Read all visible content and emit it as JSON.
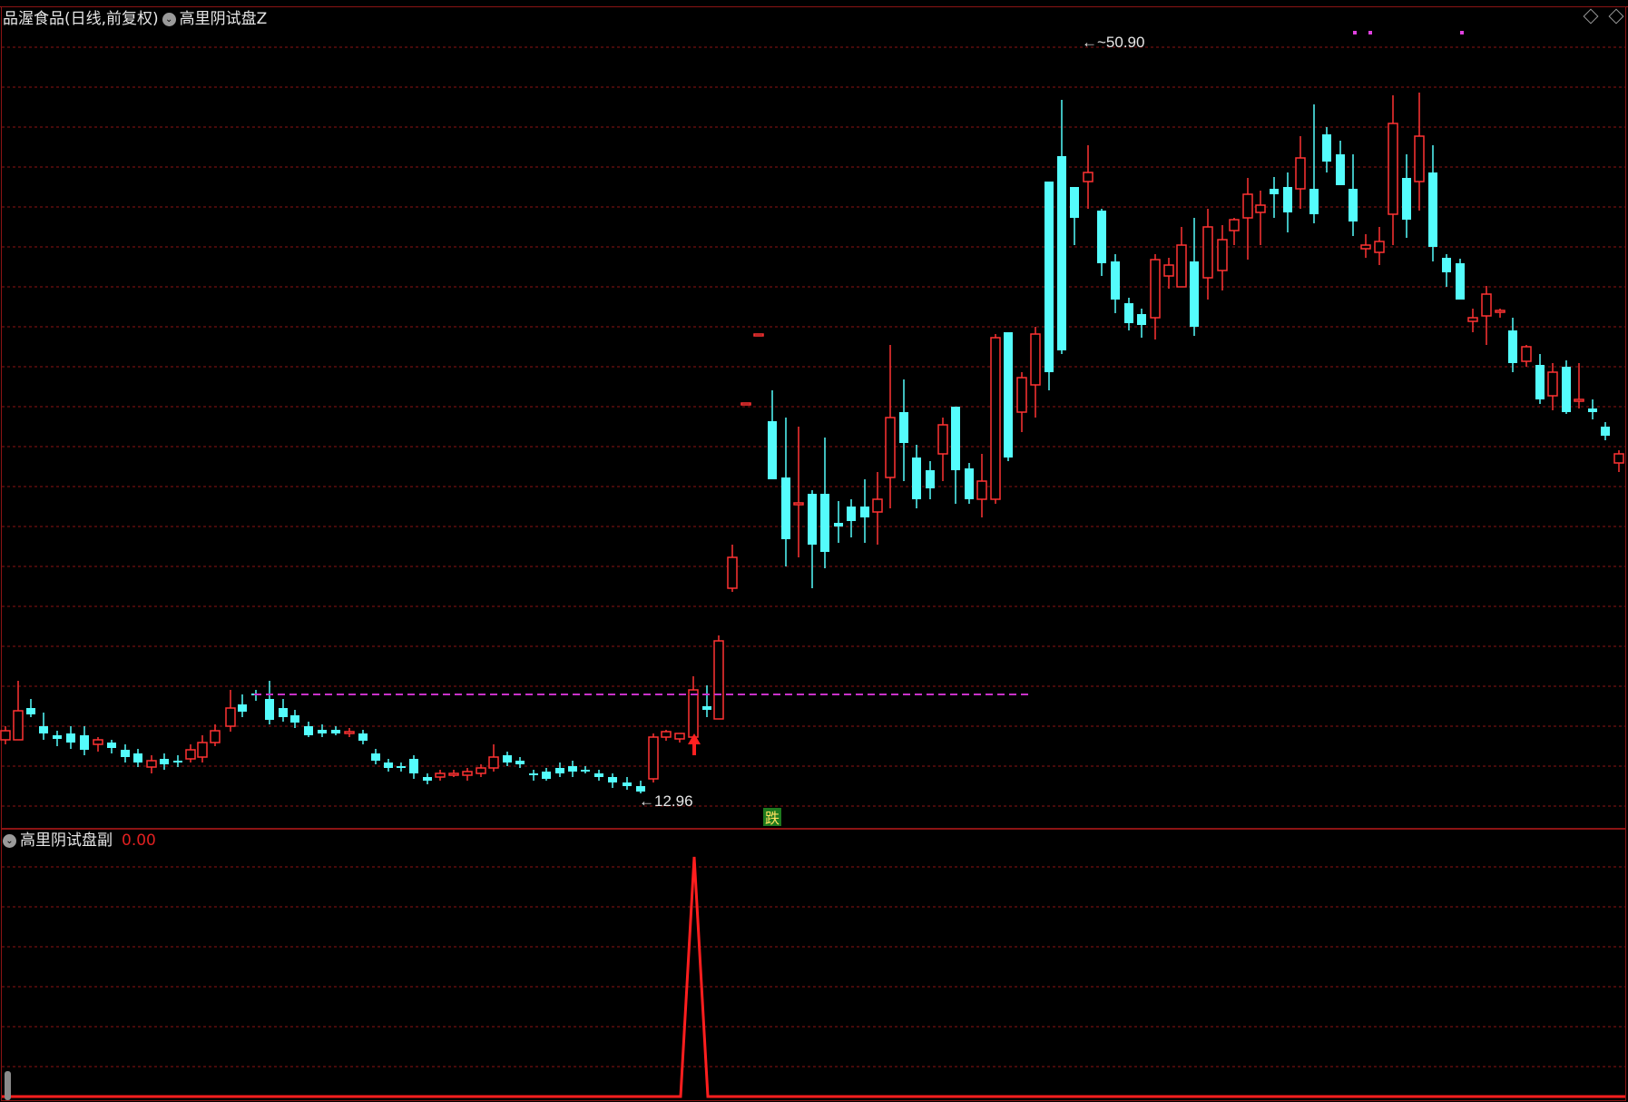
{
  "main_chart": {
    "stock_name": "品渥食品(日线,前复权)",
    "indicator_name": "高里阴试盘Z",
    "high_label": "50.90",
    "low_label": "12.96",
    "signal_badge": "跌",
    "colors": {
      "up": "#ff3232",
      "down": "#54fcfc",
      "grid": "#8c1414",
      "dashline": "#c832c8",
      "bg": "#000000"
    }
  },
  "sub_chart": {
    "indicator_name": "高里阴试盘副",
    "value_label": "0.00",
    "line_color": "#ff1e1e"
  },
  "chart_data": {
    "type": "candlestick",
    "price_high": 50.9,
    "price_low": 12.96,
    "sub_indicator_values": [
      {
        "series": "高里阴试盘副",
        "peak": 1,
        "baseline": 0
      }
    ]
  },
  "icons": {
    "collapse_main": "chevron-down-icon",
    "collapse_sub": "chevron-down-icon",
    "settings": "diamond-icon"
  }
}
